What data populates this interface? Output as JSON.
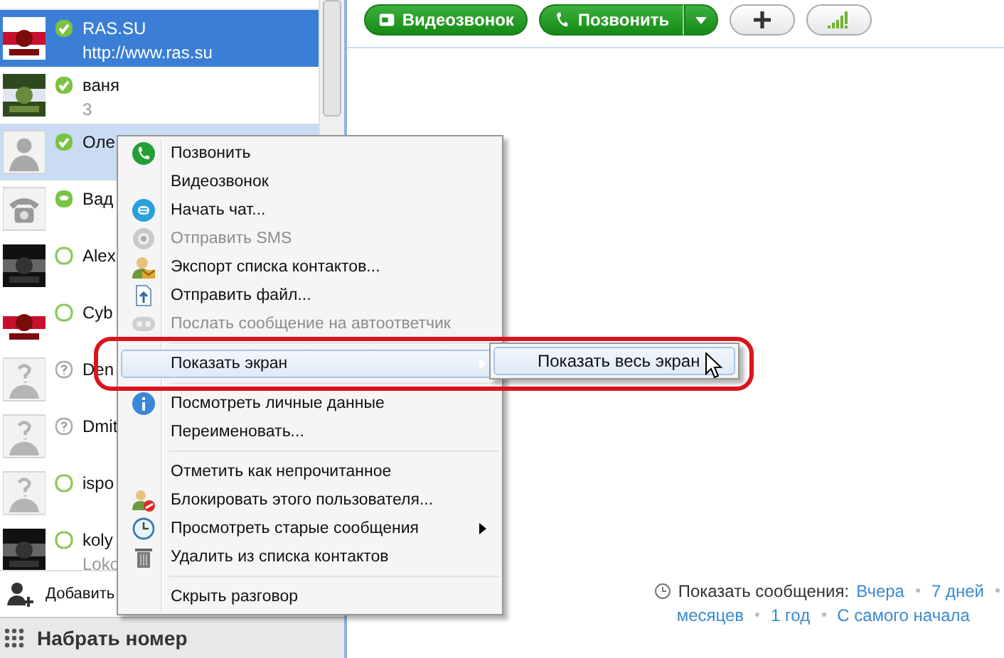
{
  "contacts": [
    {
      "name": "RAS.SU",
      "subtitle": "http://www.ras.su",
      "kind": "online",
      "selected": true,
      "hovered": false
    },
    {
      "name": "ваня",
      "subtitle": "3",
      "kind": "online",
      "selected": false,
      "hovered": false
    },
    {
      "name": "Оле",
      "kind": "online",
      "selected": false,
      "hovered": true
    },
    {
      "name": "Вад",
      "kind": "phone",
      "selected": false,
      "hovered": false
    },
    {
      "name": "Alex",
      "kind": "offline",
      "selected": false,
      "hovered": false
    },
    {
      "name": "Cyb",
      "kind": "offline",
      "selected": false,
      "hovered": false
    },
    {
      "name": "Den",
      "kind": "unknown",
      "selected": false,
      "hovered": false
    },
    {
      "name": "Dmit",
      "kind": "unknown",
      "selected": false,
      "hovered": false
    },
    {
      "name": "ispo",
      "kind": "offline",
      "selected": false,
      "hovered": false
    },
    {
      "name": "koly",
      "subtitle": "Loko",
      "kind": "offline",
      "selected": false,
      "hovered": false
    }
  ],
  "add_contact": {
    "label": "Добавить"
  },
  "dial": {
    "label": "Набрать номер"
  },
  "toolbar": [
    {
      "kind": "video",
      "label": "Видеозвонок"
    },
    {
      "kind": "call",
      "label": "Позвонить"
    },
    {
      "kind": "add"
    },
    {
      "kind": "signal"
    }
  ],
  "context_menu": [
    {
      "kind": "phone",
      "label": "Позвонить",
      "disabled": false,
      "selected": false,
      "submenu": false
    },
    {
      "kind": "plain",
      "label": "Видеозвонок",
      "disabled": false,
      "selected": false,
      "submenu": false
    },
    {
      "kind": "chat",
      "label": "Начать чат...",
      "disabled": false,
      "selected": false,
      "submenu": false
    },
    {
      "kind": "sms",
      "label": "Отправить SMS",
      "disabled": true,
      "selected": false,
      "submenu": false
    },
    {
      "kind": "export",
      "label": "Экспорт списка контактов...",
      "disabled": false,
      "selected": false,
      "submenu": false
    },
    {
      "kind": "file",
      "label": "Отправить файл...",
      "disabled": false,
      "selected": false,
      "submenu": false
    },
    {
      "kind": "voicemail",
      "label": "Послать сообщение на автоответчик",
      "disabled": true,
      "selected": false,
      "submenu": false
    },
    {
      "kind": "separator"
    },
    {
      "kind": "plain",
      "label": "Показать экран",
      "disabled": false,
      "selected": true,
      "submenu": true
    },
    {
      "kind": "separator"
    },
    {
      "kind": "info",
      "label": "Посмотреть личные данные",
      "disabled": false,
      "selected": false,
      "submenu": false
    },
    {
      "kind": "plain",
      "label": "Переименовать...",
      "disabled": false,
      "selected": false,
      "submenu": false
    },
    {
      "kind": "separator"
    },
    {
      "kind": "plain",
      "label": "Отметить как непрочитанное",
      "disabled": false,
      "selected": false,
      "submenu": false
    },
    {
      "kind": "block",
      "label": "Блокировать этого пользователя...",
      "disabled": false,
      "selected": false,
      "submenu": false
    },
    {
      "kind": "clock",
      "label": "Просмотреть старые сообщения",
      "disabled": false,
      "selected": false,
      "submenu": true
    },
    {
      "kind": "trash",
      "label": "Удалить из списка контактов",
      "disabled": false,
      "selected": false,
      "submenu": false
    },
    {
      "kind": "separator"
    },
    {
      "kind": "plain",
      "label": "Скрыть разговор",
      "disabled": false,
      "selected": false,
      "submenu": false
    }
  ],
  "submenu": [
    {
      "label": "Показать весь экран",
      "selected": true
    }
  ],
  "history": {
    "label": "Показать сообщения:",
    "links": [
      {
        "label": "Вчера"
      },
      {
        "label": "7 дней"
      },
      {
        "label": "месяцев"
      },
      {
        "label": "1 год"
      },
      {
        "label": "С самого начала"
      }
    ]
  }
}
